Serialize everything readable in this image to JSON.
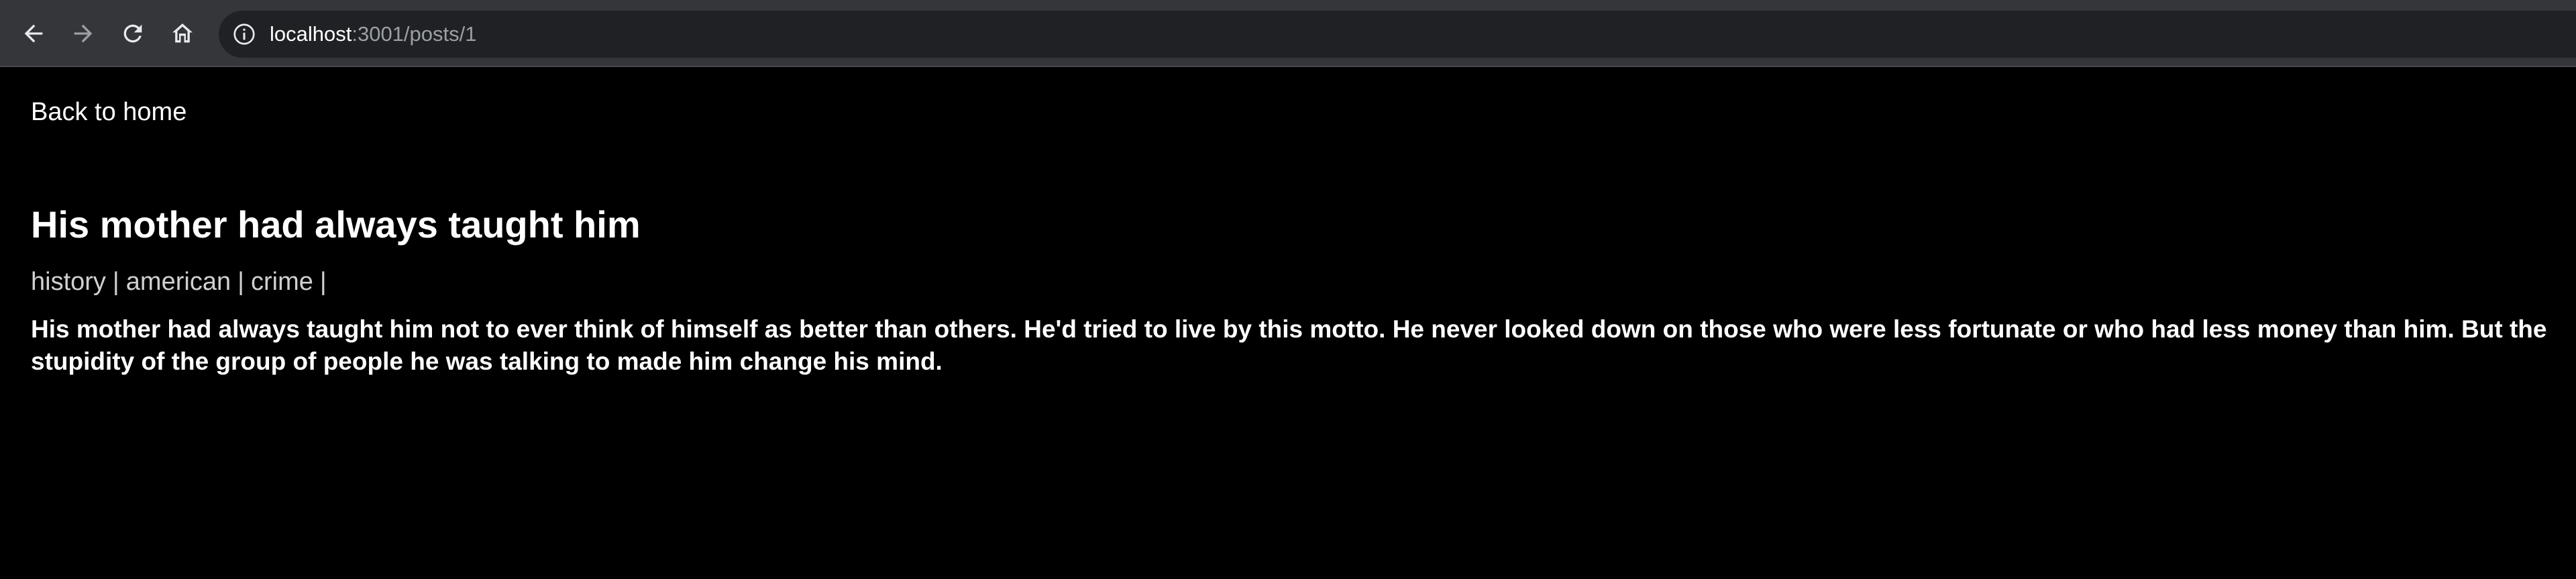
{
  "browser": {
    "url_host": "localhost",
    "url_path": ":3001/posts/1",
    "icons": [
      "back-arrow-icon",
      "forward-arrow-icon",
      "reload-icon",
      "home-icon",
      "info-icon"
    ]
  },
  "page": {
    "back_link": "Back to home",
    "title": "His mother had always taught him",
    "tags": [
      "history",
      "american",
      "crime"
    ],
    "tag_separator": "|",
    "body": "His mother had always taught him not to ever think of himself as better than others. He'd tried to live by this motto. He never looked down on those who were less fortunate or who had less money than him. But the stupidity of the group of people he was talking to made him change his mind."
  },
  "colors": {
    "background": "#000000",
    "toolbar": "#35363a",
    "omnibox": "#202124",
    "text": "#ffffff",
    "tag_text": "#d0d0d0"
  }
}
